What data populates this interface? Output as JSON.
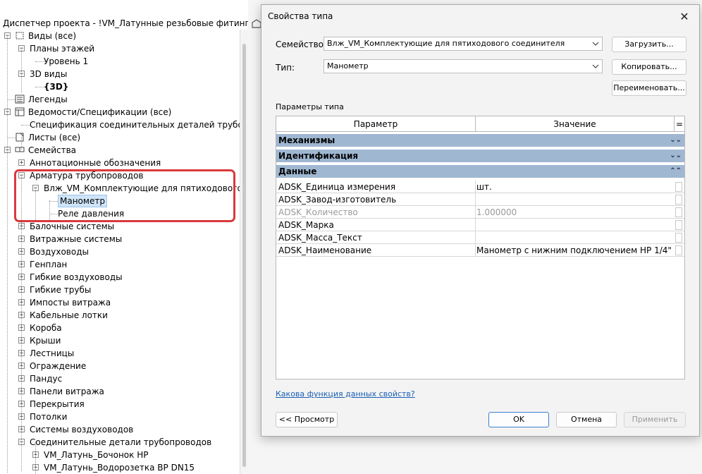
{
  "browser": {
    "title": "Диспетчер проекта - !VM_Латунные резьбовые фитинги.rvt",
    "items": [
      {
        "label": "Виды (все)",
        "expander": "−",
        "icon": "views-icon"
      },
      {
        "label": "Планы этажей",
        "expander": "−"
      },
      {
        "label": "Уровень 1"
      },
      {
        "label": "3D виды",
        "expander": "−"
      },
      {
        "label": "{3D}"
      },
      {
        "label": "Легенды",
        "icon": "legend-icon"
      },
      {
        "label": "Ведомости/Спецификации (все)",
        "expander": "−",
        "icon": "schedule-icon"
      },
      {
        "label": "Спецификация соединительных деталей трубопрово"
      },
      {
        "label": "Листы (все)",
        "icon": "sheets-icon"
      },
      {
        "label": "Семейства",
        "expander": "−",
        "icon": "families-icon"
      },
      {
        "label": "Аннотационные обозначения",
        "expander": "+"
      },
      {
        "label": "Арматура трубопроводов",
        "expander": "−"
      },
      {
        "label": "Влж_VM_Комплектующие для пятиходового сое",
        "expander": "−"
      },
      {
        "label": "Манометр",
        "selected": true
      },
      {
        "label": "Реле давления"
      },
      {
        "label": "Балочные системы",
        "expander": "+"
      },
      {
        "label": "Витражные системы",
        "expander": "+"
      },
      {
        "label": "Воздуховоды",
        "expander": "+"
      },
      {
        "label": "Генплан",
        "expander": "+"
      },
      {
        "label": "Гибкие воздуховоды",
        "expander": "+"
      },
      {
        "label": "Гибкие трубы",
        "expander": "+"
      },
      {
        "label": "Импосты витража",
        "expander": "+"
      },
      {
        "label": "Кабельные лотки",
        "expander": "+"
      },
      {
        "label": "Короба",
        "expander": "+"
      },
      {
        "label": "Крыши",
        "expander": "+"
      },
      {
        "label": "Лестницы",
        "expander": "+"
      },
      {
        "label": "Ограждение",
        "expander": "+"
      },
      {
        "label": "Пандус",
        "expander": "+"
      },
      {
        "label": "Панели витража",
        "expander": "+"
      },
      {
        "label": "Перекрытия",
        "expander": "+"
      },
      {
        "label": "Потолки",
        "expander": "+"
      },
      {
        "label": "Системы воздуховодов",
        "expander": "+"
      },
      {
        "label": "Соединительные детали трубопроводов",
        "expander": "−"
      },
      {
        "label": "VM_Латунь_Бочонок НР",
        "expander": "+"
      },
      {
        "label": "VM_Латунь_Водорозетка ВР DN15",
        "expander": "+"
      }
    ]
  },
  "dialog": {
    "title": "Свойства типа",
    "close": "✕",
    "family_label": "Семейство:",
    "family_value": "Влж_VM_Комплектующие для пятиходового соединителя",
    "type_label": "Тип:",
    "type_value": "Манометр",
    "load_button": "Загрузить...",
    "copy_button": "Копировать...",
    "rename_button": "Переименовать...",
    "params_label": "Параметры типа",
    "col_param": "Параметр",
    "col_value": "Значение",
    "col_eq": "=",
    "groups": [
      {
        "name": "Механизмы",
        "chevron": "⌄⌄"
      },
      {
        "name": "Идентификация",
        "chevron": "⌄⌄"
      },
      {
        "name": "Данные",
        "chevron": "⌃⌃"
      }
    ],
    "params": [
      {
        "name": "ADSK_Единица измерения",
        "value": "шт.",
        "disabled": false
      },
      {
        "name": "ADSK_Завод-изготовитель",
        "value": "",
        "disabled": false
      },
      {
        "name": "ADSK_Количество",
        "value": "1.000000",
        "disabled": true
      },
      {
        "name": "ADSK_Марка",
        "value": "",
        "disabled": false
      },
      {
        "name": "ADSK_Масса_Текст",
        "value": "",
        "disabled": false
      },
      {
        "name": "ADSK_Наименование",
        "value": "Манометр с нижним подключением НР 1/4\"",
        "disabled": false
      }
    ],
    "help_link": "Какова функция данных свойств?",
    "preview_button": "<< Просмотр",
    "ok_button": "OK",
    "cancel_button": "Отмена",
    "apply_button": "Применить"
  }
}
